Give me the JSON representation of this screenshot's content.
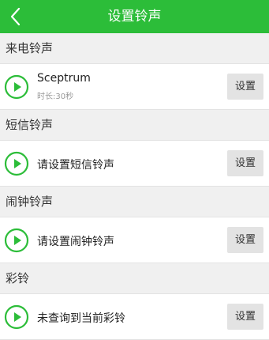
{
  "header": {
    "title": "设置铃声",
    "back_icon": "chevron-left-icon",
    "color": "#2cbd39"
  },
  "sections": {
    "call": {
      "heading": "来电铃声",
      "ring_name": "Sceptrum",
      "ring_duration": "时长:30秒",
      "set_label": "设置"
    },
    "sms": {
      "heading": "短信铃声",
      "ring_name": "请设置短信铃声",
      "set_label": "设置"
    },
    "alarm": {
      "heading": "闹钟铃声",
      "ring_name": "请设置闹钟铃声",
      "set_label": "设置"
    },
    "color_ring": {
      "heading": "彩铃",
      "ring_name": "未查询到当前彩铃",
      "set_label": "设置"
    }
  },
  "icons": {
    "play": "play-circle-icon"
  },
  "accent_color": "#2cbd39"
}
